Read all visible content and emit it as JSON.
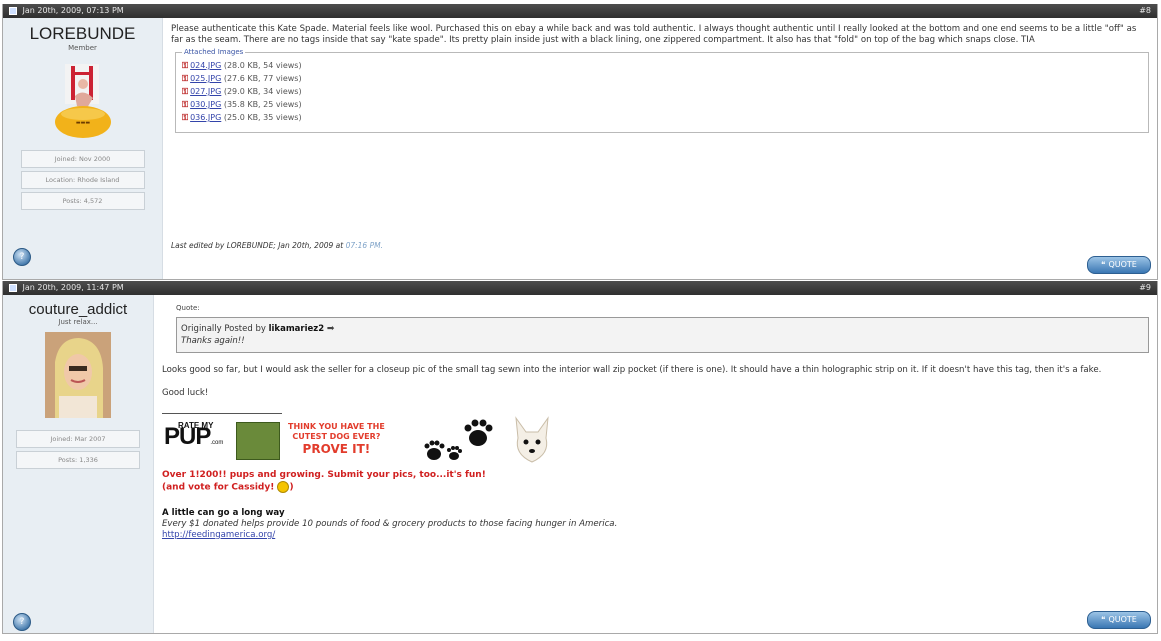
{
  "colors": {
    "header_bg": "#3d3d3d",
    "sidebar_bg": "#e8eef3",
    "link": "#3344aa",
    "signature_red": "#d02020",
    "button_blue": "#3a77b3"
  },
  "posts": [
    {
      "header_date": "Jan 20th, 2009, 07:13 PM",
      "post_number": "#8",
      "username": "LOREBUNDE",
      "user_title": "Member",
      "stats": [
        "Joined: Nov 2000",
        "Location: Rhode Island",
        "Posts: 4,572"
      ],
      "message": "Please authenticate this Kate Spade. Material feels like wool. Purchased this on ebay a while back and was told authentic. I always thought authentic until I really looked at the bottom and one end seems to be a little \"off\" as far as the seam. There are no tags inside that say \"kate spade\". Its pretty plain inside just with a black lining, one zippered compartment. It also has that \"fold\" on top of the bag which snaps close. TIA",
      "attachments_legend": "Attached Images",
      "attachments": [
        {
          "name": "024.JPG",
          "meta": "(28.0 KB, 54 views)"
        },
        {
          "name": "025.JPG",
          "meta": "(27.6 KB, 77 views)"
        },
        {
          "name": "027.JPG",
          "meta": "(29.0 KB, 34 views)"
        },
        {
          "name": "030.JPG",
          "meta": "(35.8 KB, 25 views)"
        },
        {
          "name": "036.JPG",
          "meta": "(25.0 KB, 35 views)"
        }
      ],
      "edited_text": "Last edited by LOREBUNDE; Jan 20th, 2009 at",
      "edited_time": "07:16 PM.",
      "quote_button": "QUOTE"
    },
    {
      "header_date": "Jan 20th, 2009, 11:47 PM",
      "post_number": "#9",
      "username": "couture_addict",
      "user_title": "Just relax...",
      "stats": [
        "Joined: Mar 2007",
        "Posts: 1,336"
      ],
      "quote_label": "Quote:",
      "quote_prefix": "Originally Posted by",
      "quote_author": "likamariez2",
      "quote_text": "Thanks again!!",
      "message": "Looks good so far, but I would ask the seller for a closeup pic of the small tag sewn into the interior wall zip pocket (if there is one). It should have a thin holographic strip on it. If it doesn't have this tag, then it's a fake.",
      "good_luck": "Good luck!",
      "banner": {
        "rate_my": "RATE MY",
        "pup": "PUP",
        "dotcom": ".com",
        "think_line1": "THINK YOU HAVE THE",
        "think_line2": "CUTEST DOG EVER?",
        "prove": "PROVE IT!"
      },
      "sig_red_1": "Over 1!200!! pups and growing. Submit your pics, too...it's fun!",
      "sig_red_2": "(and vote for Cassidy!",
      "sig_bold": "A little can go a long way",
      "sig_italic": "Every $1 donated helps provide 10 pounds of food & grocery products to those facing hunger in America.",
      "sig_link": "http://feedingamerica.org/",
      "quote_button": "QUOTE"
    }
  ]
}
